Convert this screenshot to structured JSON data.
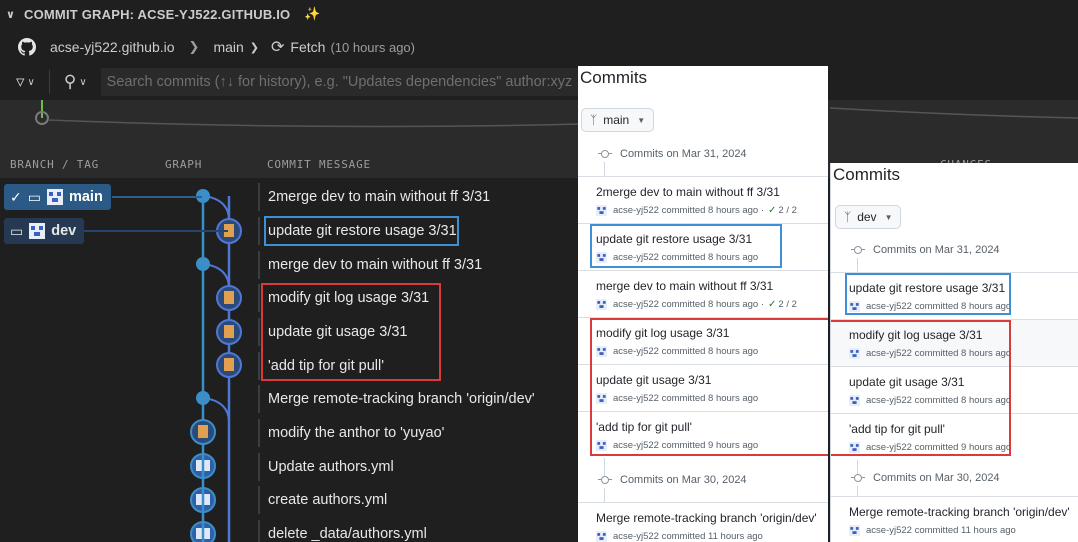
{
  "header": {
    "title": "COMMIT GRAPH: ACSE-YJ522.GITHUB.IO"
  },
  "toolbar": {
    "repo": "acse-yj522.github.io",
    "branch": "main",
    "fetch_label": "Fetch",
    "fetch_time": "(10 hours ago)"
  },
  "search": {
    "placeholder": "Search commits (↑↓ for history), e.g. \"Updates dependencies\" author:xyz"
  },
  "columns": {
    "branch": "BRANCH / TAG",
    "graph": "GRAPH",
    "message": "COMMIT MESSAGE",
    "changes": "CHANGES"
  },
  "branches": [
    {
      "label": "main"
    },
    {
      "label": "dev"
    }
  ],
  "commits": [
    {
      "message": "2merge dev to main without ff 3/31"
    },
    {
      "message": "update git restore usage 3/31"
    },
    {
      "message": "merge dev to main without ff 3/31"
    },
    {
      "message": "modify git log usage 3/31"
    },
    {
      "message": "update git usage 3/31"
    },
    {
      "message": "'add tip for git pull'"
    },
    {
      "message": "Merge remote-tracking branch 'origin/dev'"
    },
    {
      "message": "modify the anthor to 'yuyao'"
    },
    {
      "message": "Update authors.yml"
    },
    {
      "message": "create authors.yml"
    },
    {
      "message": "delete _data/authors.yml"
    }
  ],
  "main_card": {
    "title": "Commits",
    "branch": "main",
    "group1": "Commits on Mar 31, 2024",
    "group2": "Commits on Mar 30, 2024",
    "commits": [
      {
        "title": "2merge dev to main without ff 3/31",
        "meta": "acse-yj522 committed 8 hours ago",
        "checks": "2 / 2"
      },
      {
        "title": "update git restore usage 3/31",
        "meta": "acse-yj522 committed 8 hours ago"
      },
      {
        "title": "merge dev to main without ff 3/31",
        "meta": "acse-yj522 committed 8 hours ago",
        "checks": "2 / 2"
      },
      {
        "title": "modify git log usage 3/31",
        "meta": "acse-yj522 committed 8 hours ago"
      },
      {
        "title": "update git usage 3/31",
        "meta": "acse-yj522 committed 8 hours ago"
      },
      {
        "title": "'add tip for git pull'",
        "meta": "acse-yj522 committed 9 hours ago"
      },
      {
        "title": "Merge remote-tracking branch 'origin/dev'",
        "meta": "acse-yj522 committed 11 hours ago"
      }
    ]
  },
  "dev_card": {
    "title": "Commits",
    "branch": "dev",
    "group1": "Commits on Mar 31, 2024",
    "group2": "Commits on Mar 30, 2024",
    "commits": [
      {
        "title": "update git restore usage 3/31",
        "meta": "acse-yj522 committed 8 hours ago"
      },
      {
        "title": "modify git log usage 3/31",
        "meta": "acse-yj522 committed 8 hours ago"
      },
      {
        "title": "update git usage 3/31",
        "meta": "acse-yj522 committed 8 hours ago"
      },
      {
        "title": "'add tip for git pull'",
        "meta": "acse-yj522 committed 9 hours ago"
      },
      {
        "title": "Merge remote-tracking branch 'origin/dev'",
        "meta": "acse-yj522 committed 11 hours ago"
      }
    ]
  },
  "colors": {
    "highlight_blue": "#3d8fd6",
    "highlight_red": "#d93b3b",
    "graph_main": "#3a8fc8",
    "graph_dev": "#4f78d6"
  }
}
